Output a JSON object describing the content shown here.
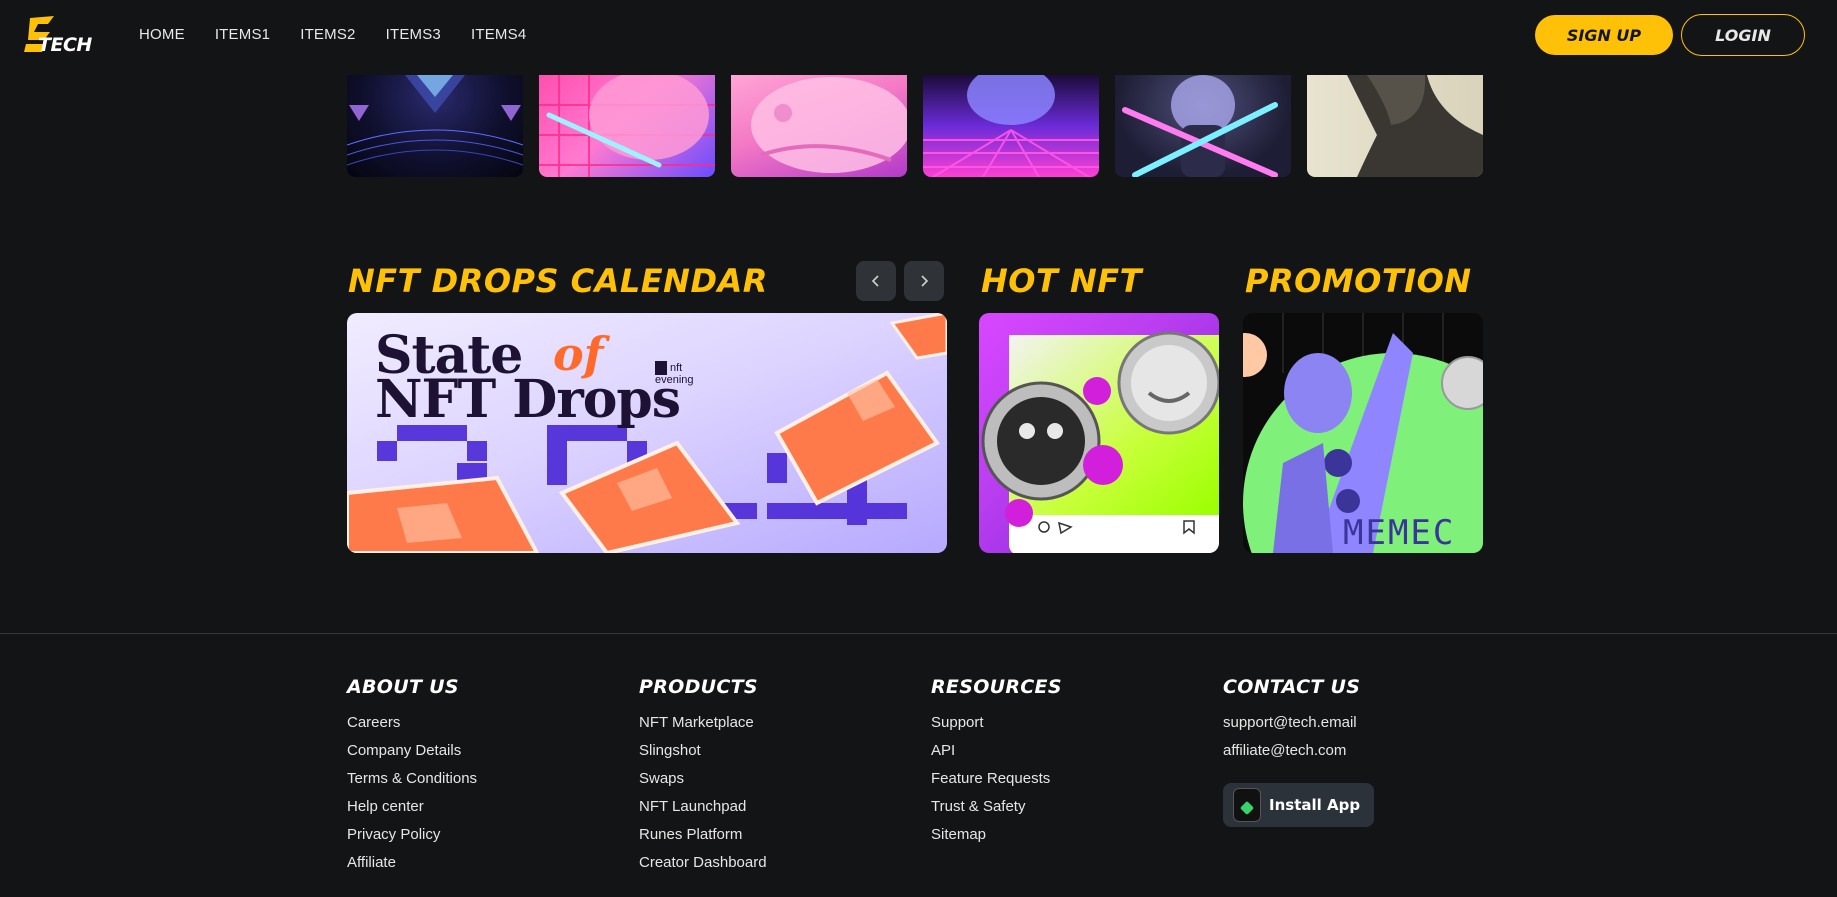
{
  "header": {
    "logo_text": "TECH",
    "nav": [
      "HOME",
      "ITEMS1",
      "ITEMS2",
      "ITEMS3",
      "ITEMS4"
    ],
    "signup_label": "SIGN UP",
    "login_label": "LOGIN"
  },
  "sections": {
    "calendar": {
      "title": "NFT DROPS CALENDAR",
      "prev_icon": "chevron-left-icon",
      "next_icon": "chevron-right-icon"
    },
    "hot": {
      "title": "HOT NFT"
    },
    "promotion": {
      "title": "PROMOTION"
    }
  },
  "calendar_card": {
    "line1": "State",
    "of": "of",
    "line2": "NFT Drops",
    "brand_top": "nft",
    "brand_bottom": "evening"
  },
  "promo_card": {
    "text": "MEMEC"
  },
  "footer": {
    "about": {
      "title": "ABOUT US",
      "links": [
        "Careers",
        "Company Details",
        "Terms & Conditions",
        "Help center",
        "Privacy Policy",
        "Affiliate"
      ]
    },
    "products": {
      "title": "PRODUCTS",
      "links": [
        "NFT Marketplace",
        "Slingshot",
        "Swaps",
        "NFT Launchpad",
        "Runes Platform",
        "Creator Dashboard"
      ]
    },
    "resources": {
      "title": "RESOURCES",
      "links": [
        "Support",
        "API",
        "Feature Requests",
        "Trust & Safety",
        "Sitemap"
      ]
    },
    "contact": {
      "title": "CONTACT US",
      "links": [
        "support@tech.email",
        "affiliate@tech.com"
      ],
      "install_label": "Install App"
    }
  },
  "colors": {
    "accent": "#ffc107",
    "background": "#121416"
  }
}
